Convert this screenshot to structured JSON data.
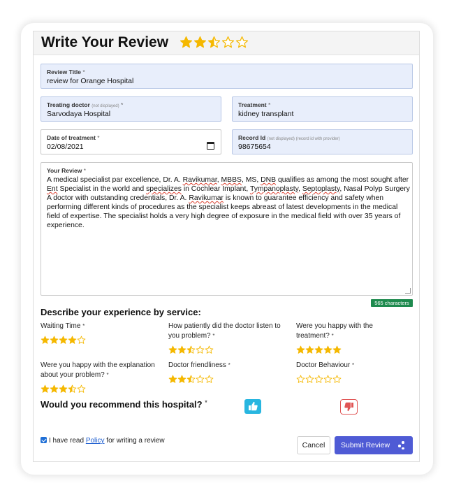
{
  "header": {
    "title": "Write Your Review",
    "overall_rating": 2.5
  },
  "fields": {
    "review_title": {
      "label": "Review Title",
      "req": "*",
      "value": "review for Orange Hospital"
    },
    "treating_doctor": {
      "label": "Treating doctor",
      "note": "(not displayed)",
      "req": "*",
      "value": "Sarvodaya Hospital"
    },
    "treatment": {
      "label": "Treatment",
      "req": "*",
      "value": "kidney transplant"
    },
    "date_of_treatment": {
      "label": "Date of treatment",
      "req": "*",
      "value": "02/08/2021"
    },
    "record_id": {
      "label": "Record Id",
      "note": "(not displayed)  (record id with provider)",
      "value": "98675654"
    },
    "your_review": {
      "label": "Your Review",
      "req": "*",
      "parts": [
        "A medical specialist par excellence, Dr. A. ",
        "Ravikumar",
        ", ",
        "MBBS",
        ", MS, ",
        "DNB",
        " qualifies as among the most sought after ",
        "Ent",
        " Specialist in the world and ",
        "specializes",
        " in Cochlear Implant, ",
        "Tympanoplasty",
        ", ",
        "Septoplasty",
        ", Nasal Polyp Surgery A doctor with outstanding credentials, Dr. A. ",
        "Ravikumar",
        " is known to guarantee efficiency and safety when performing different kinds of procedures as the specialist keeps abreast of latest developments in the medical field of expertise. The specialist holds a very high degree of exposure in the medical field with over 35 years of experience."
      ]
    }
  },
  "char_count": "565 characters",
  "services": {
    "heading": "Describe your experience by service:",
    "items": [
      {
        "label": "Waiting Time",
        "req": "*",
        "rating": 4
      },
      {
        "label": "How patiently did the doctor listen to you problem?",
        "req": "*",
        "rating": 2.5
      },
      {
        "label": "Were you happy with the treatment?",
        "req": "*",
        "rating": 5
      },
      {
        "label": "Were you happy with the explanation about your problem?",
        "req": "*",
        "rating": 3.5
      },
      {
        "label": "Doctor friendliness",
        "req": "*",
        "rating": 2.5
      },
      {
        "label": "Doctor Behaviour",
        "req": "*",
        "rating": 0
      }
    ]
  },
  "recommend": {
    "label": "Would you recommend this hospital?",
    "req": "*"
  },
  "policy": {
    "prefix": "I have read",
    "link": "Policy",
    "suffix": "for writing a review",
    "checked": true
  },
  "buttons": {
    "cancel": "Cancel",
    "submit": "Submit Review"
  },
  "colors": {
    "star": "#f5b800",
    "accent": "#4f5bd5",
    "field_bg": "#e8eefb",
    "thumb_up": "#28b6e0",
    "thumb_down": "#e05555",
    "count_badge": "#1e8a4e"
  }
}
